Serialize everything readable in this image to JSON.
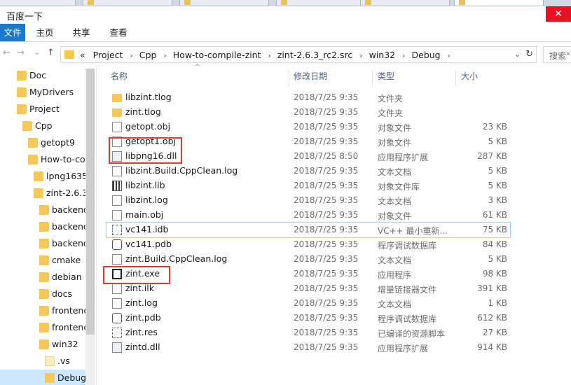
{
  "window": {
    "title": "百度一下",
    "close_glyph": "✕"
  },
  "ribbon": {
    "tabs": [
      "文件",
      "主页",
      "共享",
      "查看"
    ]
  },
  "nav": {
    "back_glyph": "←",
    "forward_glyph": "→",
    "recent_glyph": "⌄",
    "up_glyph": "↑"
  },
  "address": {
    "lead": "«",
    "crumbs": [
      "Project",
      "Cpp",
      "How-to-compile-zint",
      "zint-2.6.3_rc2.src",
      "win32",
      "Debug"
    ],
    "sep_glyph": "›",
    "dropdown_glyph": "⌄",
    "refresh_glyph": "↻"
  },
  "search": {
    "placeholder": "搜索\""
  },
  "tree": {
    "items": [
      {
        "label": "Doc"
      },
      {
        "label": "MyDrivers"
      },
      {
        "label": "Project"
      },
      {
        "label": "Cpp"
      },
      {
        "label": "getopt9"
      },
      {
        "label": "How-to-co"
      },
      {
        "label": "lpng1635"
      },
      {
        "label": "zint-2.6.3_"
      },
      {
        "label": "backend"
      },
      {
        "label": "backend"
      },
      {
        "label": "backend"
      },
      {
        "label": "cmake"
      },
      {
        "label": "debian"
      },
      {
        "label": "docs"
      },
      {
        "label": "frontend"
      },
      {
        "label": "frontend"
      },
      {
        "label": "win32"
      },
      {
        "label": ".vs"
      },
      {
        "label": "Debug"
      }
    ]
  },
  "columns": {
    "name": "名称",
    "date": "修改日期",
    "type": "类型",
    "size": "大小",
    "sort_glyph": "^"
  },
  "files": [
    {
      "name": "libzint.tlog",
      "date": "2018/7/25 9:35",
      "type": "文件夹",
      "size": "",
      "icon": "folder-icon"
    },
    {
      "name": "zint.tlog",
      "date": "2018/7/25 9:35",
      "type": "文件夹",
      "size": "",
      "icon": "folder-icon"
    },
    {
      "name": "getopt.obj",
      "date": "2018/7/25 9:35",
      "type": "对象文件",
      "size": "23 KB",
      "icon": "obj-file-icon"
    },
    {
      "name": "getopt1.obj",
      "date": "2018/7/25 9:35",
      "type": "对象文件",
      "size": "5 KB",
      "icon": "obj-file-icon"
    },
    {
      "name": "libpng16.dll",
      "date": "2018/7/25 8:50",
      "type": "应用程序扩展",
      "size": "287 KB",
      "icon": "dll-file-icon"
    },
    {
      "name": "libzint.Build.CppClean.log",
      "date": "2018/7/25 9:35",
      "type": "文本文档",
      "size": "5 KB",
      "icon": "text-file-icon"
    },
    {
      "name": "libzint.lib",
      "date": "2018/7/25 9:35",
      "type": "对象文件库",
      "size": "5 KB",
      "icon": "lib-file-icon"
    },
    {
      "name": "libzint.log",
      "date": "2018/7/25 9:35",
      "type": "文本文档",
      "size": "3 KB",
      "icon": "text-file-icon"
    },
    {
      "name": "main.obj",
      "date": "2018/7/25 9:35",
      "type": "对象文件",
      "size": "61 KB",
      "icon": "obj-file-icon"
    },
    {
      "name": "vc141.idb",
      "date": "2018/7/25 9:35",
      "type": "VC++ 最小重新...",
      "size": "75 KB",
      "icon": "idb-file-icon"
    },
    {
      "name": "vc141.pdb",
      "date": "2018/7/25 9:35",
      "type": "程序调试数据库",
      "size": "84 KB",
      "icon": "pdb-file-icon"
    },
    {
      "name": "zint.Build.CppClean.log",
      "date": "2018/7/25 9:35",
      "type": "文本文档",
      "size": "5 KB",
      "icon": "text-file-icon"
    },
    {
      "name": "zint.exe",
      "date": "2018/7/25 9:35",
      "type": "应用程序",
      "size": "98 KB",
      "icon": "exe-file-icon"
    },
    {
      "name": "zint.ilk",
      "date": "2018/7/25 9:35",
      "type": "增量链接器文件",
      "size": "391 KB",
      "icon": "ilk-file-icon"
    },
    {
      "name": "zint.log",
      "date": "2018/7/25 9:35",
      "type": "文本文档",
      "size": "1 KB",
      "icon": "text-file-icon"
    },
    {
      "name": "zint.pdb",
      "date": "2018/7/25 9:35",
      "type": "程序调试数据库",
      "size": "612 KB",
      "icon": "pdb-file-icon"
    },
    {
      "name": "zint.res",
      "date": "2018/7/25 9:35",
      "type": "已编译的资源脚本",
      "size": "27 KB",
      "icon": "res-file-icon"
    },
    {
      "name": "zintd.dll",
      "date": "2018/7/25 9:35",
      "type": "应用程序扩展",
      "size": "914 KB",
      "icon": "dll-file-icon"
    }
  ],
  "colors": {
    "accent": "#1979ca",
    "folder": "#f4c85a",
    "annotation": "#e53935",
    "selection": "#cce8ff"
  }
}
